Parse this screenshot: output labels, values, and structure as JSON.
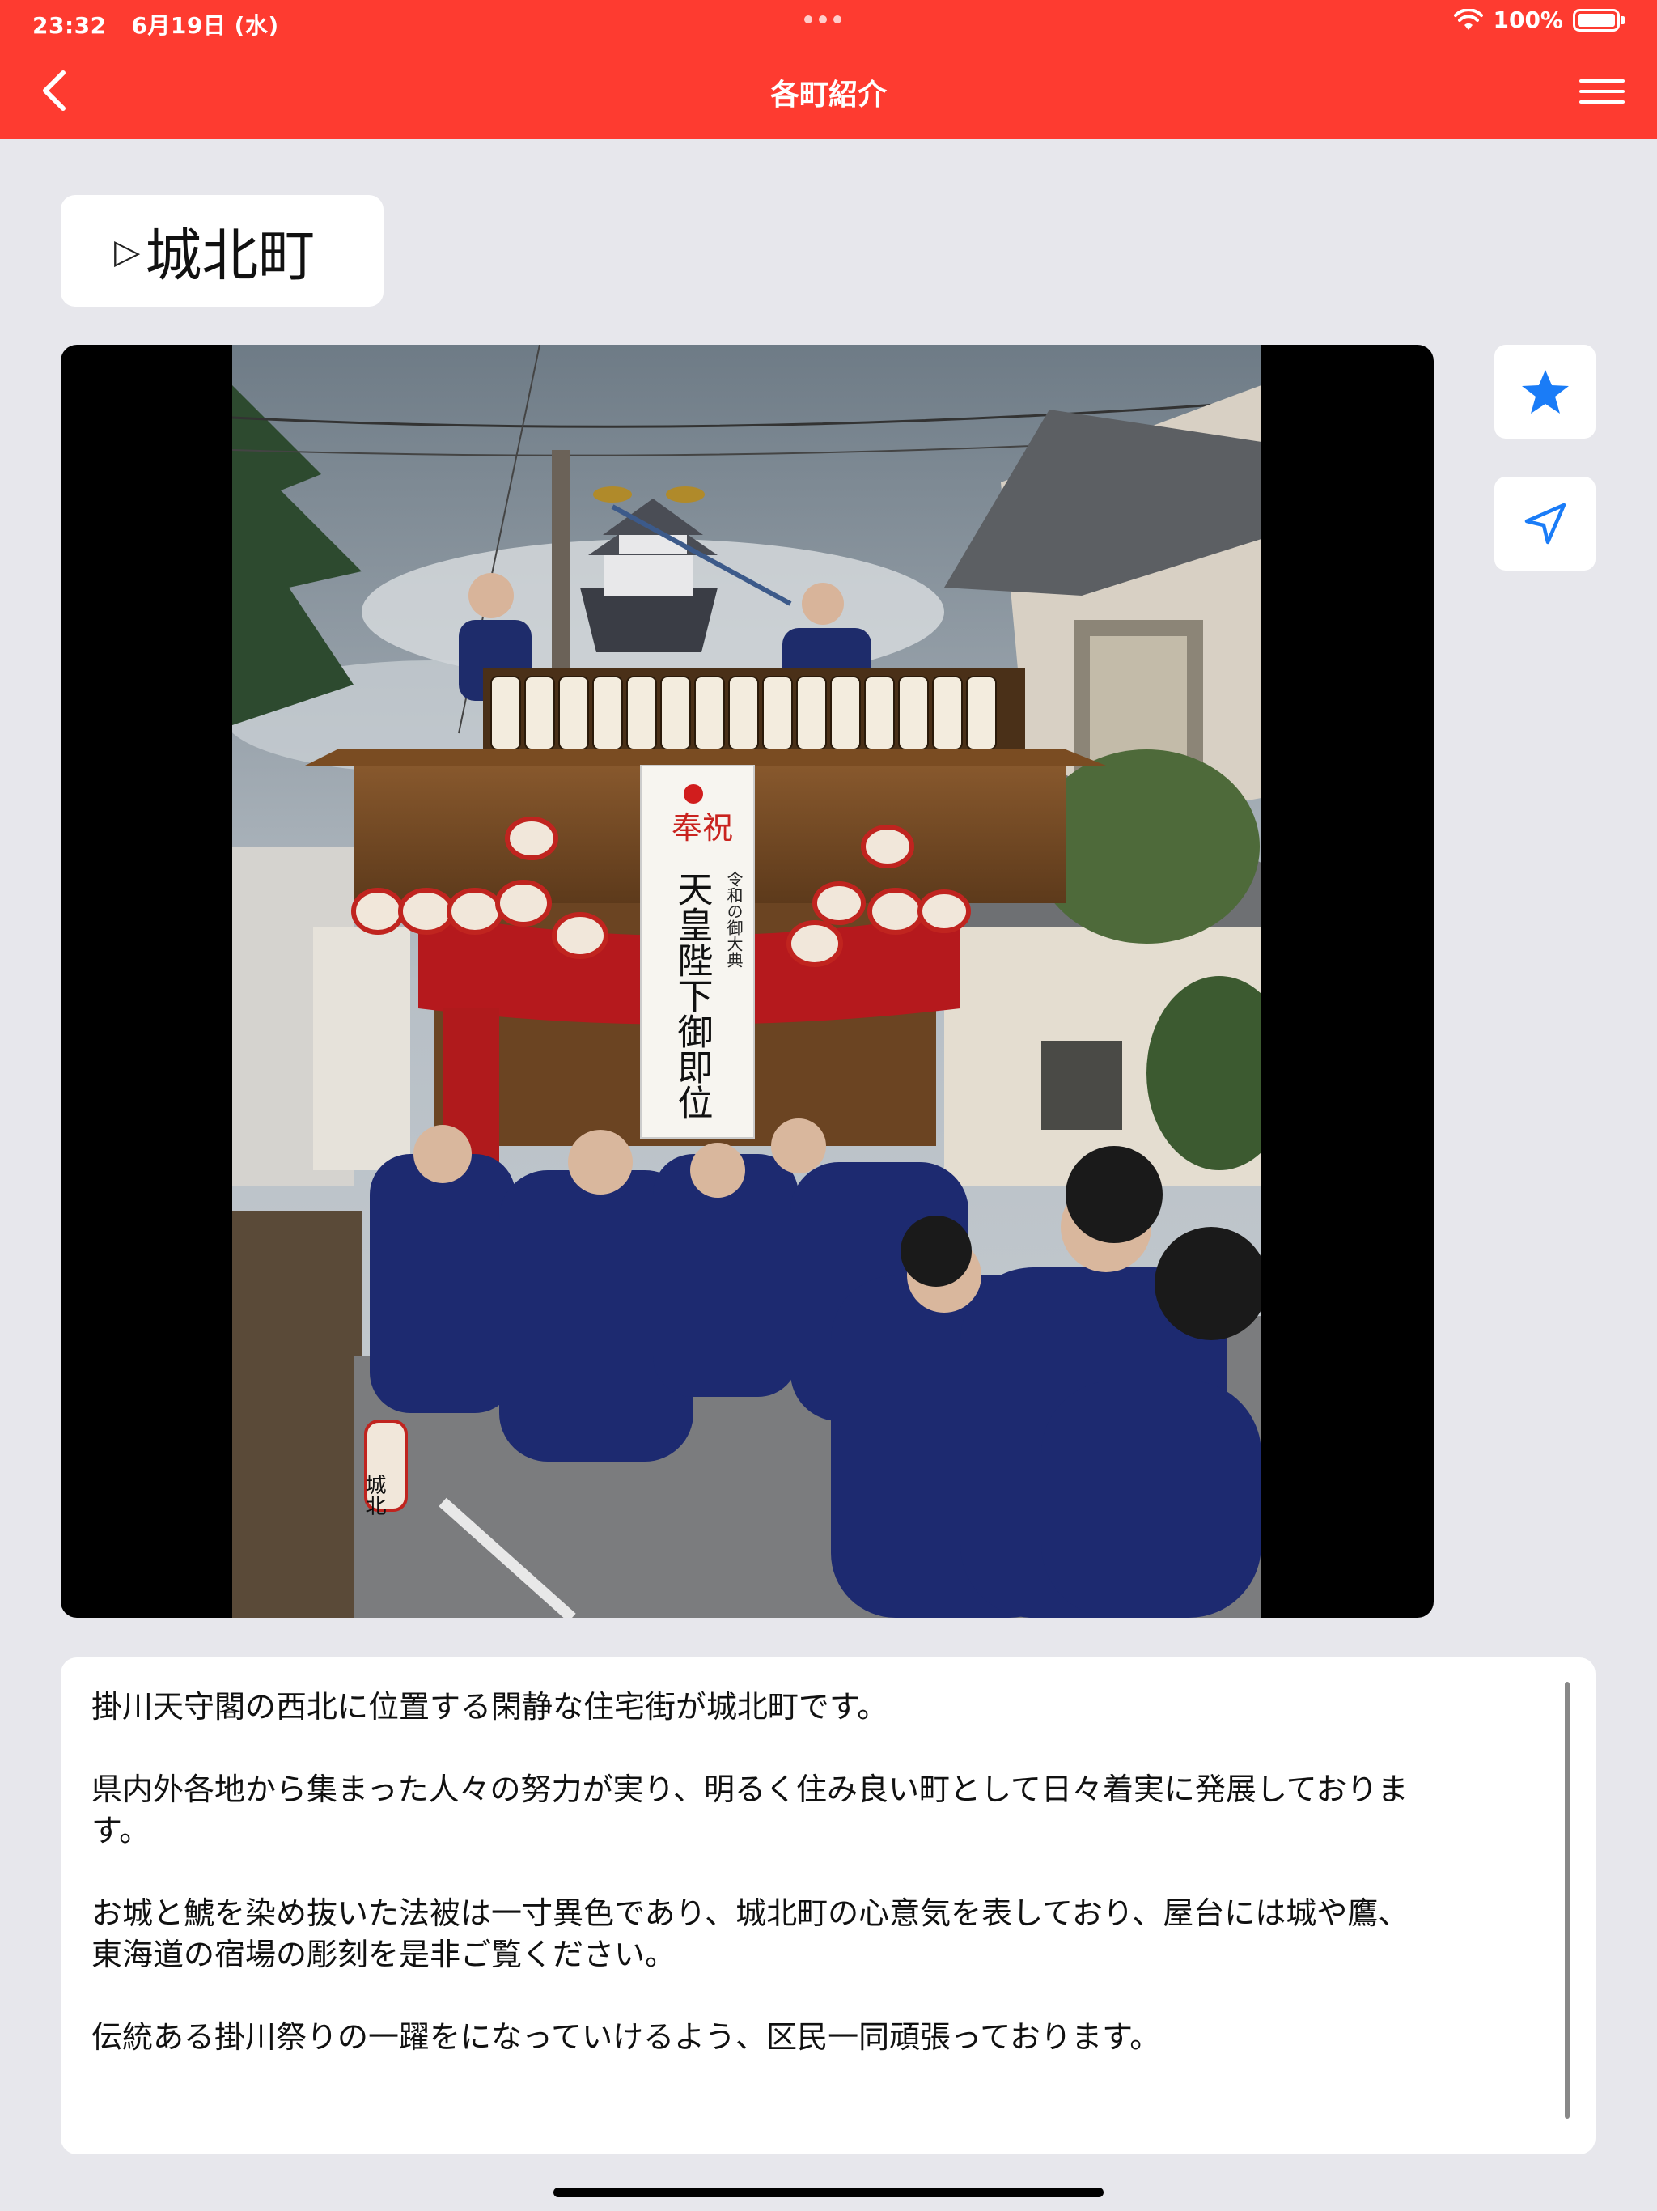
{
  "status_bar": {
    "time": "23:32",
    "date": "6月19日 (水)",
    "battery": "100%"
  },
  "nav": {
    "title": "各町紹介",
    "back_icon": "chevron-left-icon",
    "menu_icon": "hamburger-menu-icon"
  },
  "town": {
    "marker": "▷",
    "name": "城北町"
  },
  "photo": {
    "alt": "城北町の屋台",
    "banner_lines": [
      "奉祝",
      "令和の御大典",
      "天皇陛下御即位"
    ],
    "lantern_text": "城北"
  },
  "actions": {
    "favorite_icon": "star-icon",
    "navigate_icon": "location-arrow-icon"
  },
  "description": {
    "paragraphs": [
      "掛川天守閣の西北に位置する閑静な住宅街が城北町です。",
      "県内外各地から集まった人々の努力が実り、明るく住み良い町として日々着実に発展しておりま\nす。",
      "お城と鯱を染め抜いた法被は一寸異色であり、城北町の心意気を表しており、屋台には城や鷹、\n東海道の宿場の彫刻を是非ご覧ください。",
      "伝統ある掛川祭りの一躍をになっていけるよう、区民一同頑張っております。"
    ]
  },
  "colors": {
    "accent": "#fe3b30",
    "background": "#e7e7ec",
    "icon_blue": "#1a7cf7"
  }
}
